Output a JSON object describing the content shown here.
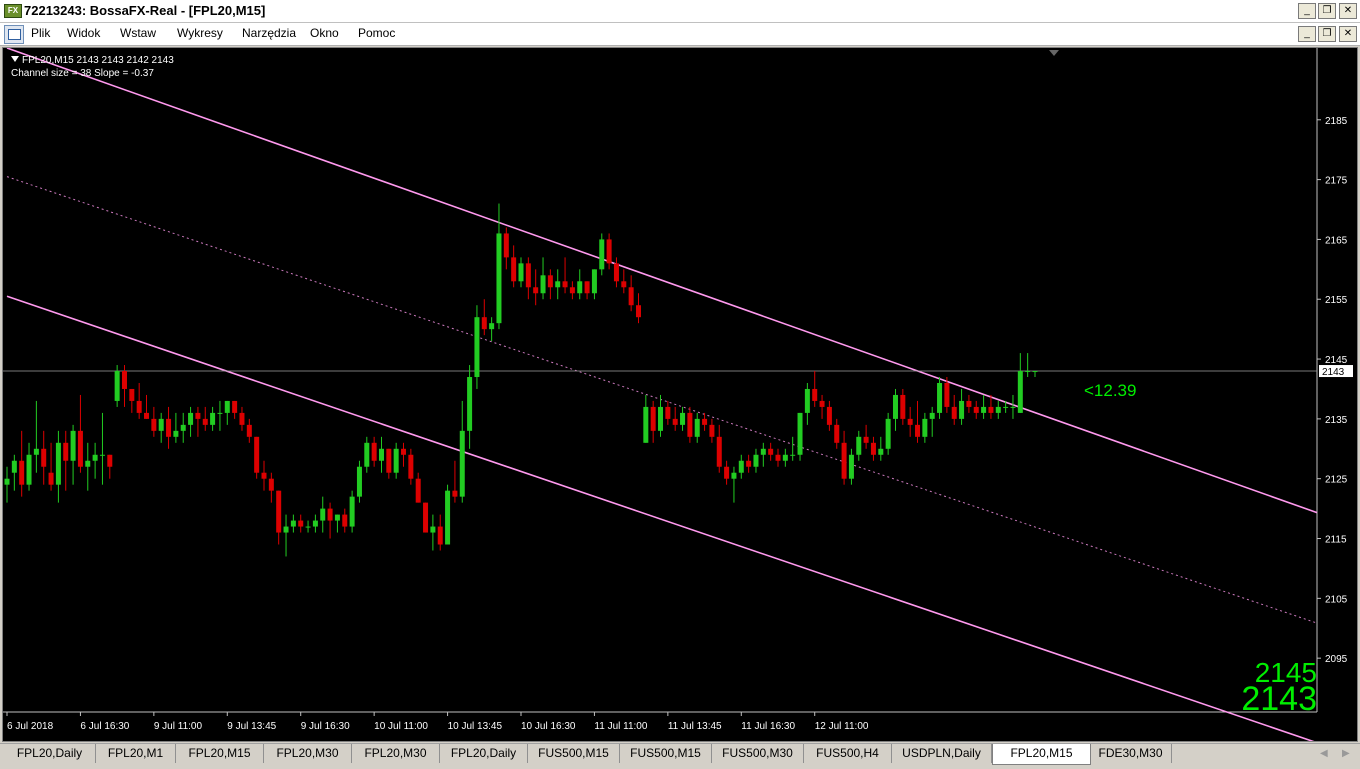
{
  "window": {
    "title": "72213243: BossaFX-Real - [FPL20,M15]",
    "icon_text": "FX",
    "minimize": "_",
    "restore": "❐",
    "close": "✕"
  },
  "menu": {
    "items": [
      "Plik",
      "Widok",
      "Wstaw",
      "Wykresy",
      "Narzędzia",
      "Okno",
      "Pomoc"
    ]
  },
  "chart_info": {
    "line1": "FPL20,M15  2143 2143 2142 2143",
    "line2": "Channel size = 38 Slope = -0.37"
  },
  "chart_data": {
    "type": "candlestick",
    "symbol": "FPL20",
    "timeframe": "M15",
    "ylim": [
      2086,
      2197
    ],
    "y_ticks": [
      2185,
      2175,
      2165,
      2155,
      2145,
      2135,
      2125,
      2115,
      2105,
      2095
    ],
    "current_price": 2143,
    "x_labels": [
      "6 Jul 2018",
      "6 Jul 16:30",
      "9 Jul 11:00",
      "9 Jul 13:45",
      "9 Jul 16:30",
      "10 Jul 11:00",
      "10 Jul 13:45",
      "10 Jul 16:30",
      "11 Jul 11:00",
      "11 Jul 13:45",
      "11 Jul 16:30",
      "12 Jul 11:00"
    ],
    "channel": {
      "upper": [
        [
          0,
          2197
        ],
        [
          147,
          2133
        ]
      ],
      "middle": [
        [
          0,
          2175.5
        ],
        [
          147,
          2114
        ]
      ],
      "lower": [
        [
          0,
          2155.5
        ],
        [
          147,
          2094
        ]
      ]
    },
    "channel_label": "<12.39",
    "big_bid": "2145",
    "big_ask": "2143",
    "colors": {
      "bull": "#22cc22",
      "bear": "#dd0000",
      "channel": "#ff99ee",
      "text_green": "#00ee00"
    },
    "candles": [
      [
        2124,
        2127,
        2121,
        2125
      ],
      [
        2126,
        2129,
        2123,
        2128
      ],
      [
        2128,
        2133,
        2122,
        2124
      ],
      [
        2124,
        2131,
        2123,
        2129
      ],
      [
        2129,
        2138,
        2126,
        2130
      ],
      [
        2130,
        2133,
        2124,
        2127
      ],
      [
        2126,
        2131,
        2123,
        2124
      ],
      [
        2124,
        2133,
        2121,
        2131
      ],
      [
        2131,
        2133,
        2123,
        2128
      ],
      [
        2128,
        2134,
        2124,
        2133
      ],
      [
        2133,
        2139,
        2126,
        2127
      ],
      [
        2127,
        2131,
        2123,
        2128
      ],
      [
        2128,
        2131,
        2125,
        2129
      ],
      [
        2129,
        2136,
        2124,
        2129
      ],
      [
        2129,
        2129,
        2125,
        2127
      ],
      [
        2138,
        2144,
        2137,
        2143
      ],
      [
        2143,
        2144,
        2137,
        2140
      ],
      [
        2140,
        2140,
        2136,
        2138
      ],
      [
        2138,
        2141,
        2135,
        2136
      ],
      [
        2136,
        2139,
        2135,
        2135
      ],
      [
        2135,
        2137,
        2132,
        2133
      ],
      [
        2133,
        2136,
        2131,
        2135
      ],
      [
        2135,
        2137,
        2130,
        2132
      ],
      [
        2132,
        2136,
        2131,
        2133
      ],
      [
        2133,
        2136,
        2131,
        2134
      ],
      [
        2134,
        2137,
        2132,
        2136
      ],
      [
        2136,
        2137,
        2132,
        2135
      ],
      [
        2135,
        2137,
        2133,
        2134
      ],
      [
        2134,
        2137,
        2133,
        2136
      ],
      [
        2136,
        2138,
        2133,
        2136
      ],
      [
        2136,
        2138,
        2134,
        2138
      ],
      [
        2138,
        2138,
        2135,
        2136
      ],
      [
        2136,
        2137,
        2133,
        2134
      ],
      [
        2134,
        2135,
        2131,
        2132
      ],
      [
        2132,
        2132,
        2125,
        2126
      ],
      [
        2126,
        2128,
        2123,
        2125
      ],
      [
        2125,
        2126,
        2121,
        2123
      ],
      [
        2123,
        2123,
        2114,
        2116
      ],
      [
        2116,
        2119,
        2112,
        2117
      ],
      [
        2117,
        2119,
        2116,
        2118
      ],
      [
        2118,
        2119,
        2116,
        2117
      ],
      [
        2117,
        2118,
        2116,
        2117
      ],
      [
        2117,
        2119,
        2116,
        2118
      ],
      [
        2118,
        2122,
        2116,
        2120
      ],
      [
        2120,
        2121,
        2115,
        2118
      ],
      [
        2118,
        2119,
        2116,
        2119
      ],
      [
        2119,
        2120,
        2116,
        2117
      ],
      [
        2117,
        2123,
        2116,
        2122
      ],
      [
        2122,
        2128,
        2121,
        2127
      ],
      [
        2127,
        2132,
        2126,
        2131
      ],
      [
        2131,
        2132,
        2127,
        2128
      ],
      [
        2128,
        2132,
        2126,
        2130
      ],
      [
        2130,
        2130,
        2125,
        2126
      ],
      [
        2126,
        2131,
        2125,
        2130
      ],
      [
        2130,
        2131,
        2127,
        2129
      ],
      [
        2129,
        2130,
        2124,
        2125
      ],
      [
        2125,
        2126,
        2121,
        2121
      ],
      [
        2121,
        2121,
        2116,
        2116
      ],
      [
        2116,
        2119,
        2113,
        2117
      ],
      [
        2117,
        2119,
        2113,
        2114
      ],
      [
        2114,
        2124,
        2114,
        2123
      ],
      [
        2123,
        2128,
        2121,
        2122
      ],
      [
        2122,
        2138,
        2121,
        2133
      ],
      [
        2133,
        2144,
        2130,
        2142
      ],
      [
        2142,
        2154,
        2140,
        2152
      ],
      [
        2152,
        2155,
        2149,
        2150
      ],
      [
        2150,
        2152,
        2148,
        2151
      ],
      [
        2151,
        2171,
        2150,
        2166
      ],
      [
        2166,
        2167,
        2160,
        2162
      ],
      [
        2162,
        2164,
        2157,
        2158
      ],
      [
        2158,
        2162,
        2157,
        2161
      ],
      [
        2161,
        2162,
        2155,
        2157
      ],
      [
        2157,
        2160,
        2154,
        2156
      ],
      [
        2156,
        2162,
        2155,
        2159
      ],
      [
        2159,
        2160,
        2155,
        2157
      ],
      [
        2157,
        2160,
        2155,
        2158
      ],
      [
        2158,
        2162,
        2156,
        2157
      ],
      [
        2157,
        2158,
        2155,
        2156
      ],
      [
        2156,
        2160,
        2155,
        2158
      ],
      [
        2158,
        2158,
        2155,
        2156
      ],
      [
        2156,
        2160,
        2155,
        2160
      ],
      [
        2160,
        2166,
        2159,
        2165
      ],
      [
        2165,
        2166,
        2160,
        2161
      ],
      [
        2161,
        2162,
        2157,
        2158
      ],
      [
        2158,
        2160,
        2156,
        2157
      ],
      [
        2157,
        2159,
        2153,
        2154
      ],
      [
        2154,
        2156,
        2151,
        2152
      ],
      [
        2131,
        2139,
        2131,
        2137
      ],
      [
        2137,
        2138,
        2131,
        2133
      ],
      [
        2133,
        2139,
        2132,
        2137
      ],
      [
        2137,
        2138,
        2134,
        2135
      ],
      [
        2135,
        2137,
        2133,
        2134
      ],
      [
        2134,
        2137,
        2133,
        2136
      ],
      [
        2136,
        2137,
        2131,
        2132
      ],
      [
        2132,
        2136,
        2131,
        2135
      ],
      [
        2135,
        2136,
        2133,
        2134
      ],
      [
        2134,
        2135,
        2131,
        2132
      ],
      [
        2132,
        2134,
        2126,
        2127
      ],
      [
        2127,
        2128,
        2124,
        2125
      ],
      [
        2125,
        2127,
        2121,
        2126
      ],
      [
        2126,
        2129,
        2125,
        2128
      ],
      [
        2128,
        2129,
        2126,
        2127
      ],
      [
        2127,
        2130,
        2126,
        2129
      ],
      [
        2129,
        2131,
        2127,
        2130
      ],
      [
        2130,
        2131,
        2128,
        2129
      ],
      [
        2129,
        2130,
        2127,
        2128
      ],
      [
        2128,
        2130,
        2127,
        2129
      ],
      [
        2129,
        2132,
        2128,
        2129
      ],
      [
        2129,
        2136,
        2128,
        2136
      ],
      [
        2136,
        2141,
        2134,
        2140
      ],
      [
        2140,
        2143,
        2137,
        2138
      ],
      [
        2138,
        2139,
        2135,
        2137
      ],
      [
        2137,
        2138,
        2133,
        2134
      ],
      [
        2134,
        2135,
        2130,
        2131
      ],
      [
        2131,
        2133,
        2124,
        2125
      ],
      [
        2125,
        2130,
        2124,
        2129
      ],
      [
        2129,
        2133,
        2128,
        2132
      ],
      [
        2132,
        2134,
        2130,
        2131
      ],
      [
        2131,
        2132,
        2128,
        2129
      ],
      [
        2129,
        2132,
        2128,
        2130
      ],
      [
        2130,
        2136,
        2129,
        2135
      ],
      [
        2135,
        2140,
        2133,
        2139
      ],
      [
        2139,
        2140,
        2134,
        2135
      ],
      [
        2135,
        2137,
        2132,
        2134
      ],
      [
        2134,
        2138,
        2131,
        2132
      ],
      [
        2132,
        2136,
        2131,
        2135
      ],
      [
        2135,
        2137,
        2132,
        2136
      ],
      [
        2136,
        2142,
        2135,
        2141
      ],
      [
        2141,
        2142,
        2136,
        2137
      ],
      [
        2137,
        2139,
        2134,
        2135
      ],
      [
        2135,
        2140,
        2134,
        2138
      ],
      [
        2138,
        2139,
        2136,
        2137
      ],
      [
        2137,
        2138,
        2135,
        2136
      ],
      [
        2136,
        2139,
        2135,
        2137
      ],
      [
        2137,
        2139,
        2135,
        2136
      ],
      [
        2136,
        2138,
        2135,
        2137
      ],
      [
        2137,
        2138,
        2136,
        2137
      ],
      [
        2137,
        2139,
        2135,
        2137
      ],
      [
        2136,
        2146,
        2136,
        2143
      ],
      [
        2143,
        2146,
        2142,
        2143
      ],
      [
        2143,
        2143,
        2142,
        2143
      ]
    ]
  },
  "tabs": [
    {
      "label": "FPL20,Daily",
      "active": false
    },
    {
      "label": "FPL20,M1",
      "active": false
    },
    {
      "label": "FPL20,M15",
      "active": false
    },
    {
      "label": "FPL20,M30",
      "active": false
    },
    {
      "label": "FPL20,M30",
      "active": false
    },
    {
      "label": "FPL20,Daily",
      "active": false
    },
    {
      "label": "FUS500,M15",
      "active": false
    },
    {
      "label": "FUS500,M15",
      "active": false
    },
    {
      "label": "FUS500,M30",
      "active": false
    },
    {
      "label": "FUS500,H4",
      "active": false
    },
    {
      "label": "USDPLN,Daily",
      "active": false
    },
    {
      "label": "FPL20,M15",
      "active": true
    },
    {
      "label": "FDE30,M30",
      "active": false
    }
  ],
  "tab_scroll": {
    "left": "◀",
    "right": "▶"
  }
}
